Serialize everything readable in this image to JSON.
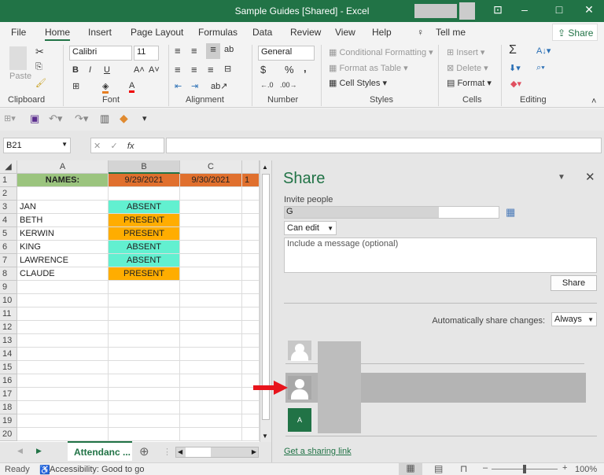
{
  "window": {
    "title": "Sample Guides [Shared]  -  Excel",
    "accent": "#217346"
  },
  "tabs": [
    "File",
    "Home",
    "Insert",
    "Page Layout",
    "Formulas",
    "Data",
    "Review",
    "View",
    "Help",
    "Tell me"
  ],
  "share_button": "Share",
  "ribbon": {
    "clipboard": {
      "label": "Clipboard",
      "paste": "Paste"
    },
    "font": {
      "label": "Font",
      "name": "Calibri",
      "size": "11",
      "bold": "B",
      "italic": "I",
      "underline": "U"
    },
    "alignment": {
      "label": "Alignment"
    },
    "number": {
      "label": "Number",
      "format": "General",
      "currency": "$",
      "percent": "%",
      "comma": ","
    },
    "styles": {
      "label": "Styles",
      "conditional": "Conditional Formatting",
      "table": "Format as Table",
      "cell_styles": "Cell Styles"
    },
    "cells": {
      "label": "Cells",
      "insert": "Insert",
      "delete": "Delete",
      "format": "Format"
    },
    "editing": {
      "label": "Editing",
      "sum": "Σ"
    }
  },
  "formula_bar": {
    "name_box": "B21",
    "fx": "fx",
    "value": ""
  },
  "sheet": {
    "columns": [
      "A",
      "B",
      "C"
    ],
    "rows": [
      "1",
      "2",
      "3",
      "4",
      "5",
      "6",
      "7",
      "8",
      "9",
      "10",
      "11",
      "12",
      "13",
      "14",
      "15",
      "16",
      "17",
      "18",
      "19",
      "20"
    ],
    "header": {
      "a": "NAMES:",
      "b": "9/29/2021",
      "c": "9/30/2021",
      "d": "1"
    },
    "records": [
      {
        "name": "JAN",
        "status": "ABSENT"
      },
      {
        "name": "BETH",
        "status": "PRESENT"
      },
      {
        "name": "KERWIN",
        "status": "PRESENT"
      },
      {
        "name": "KING",
        "status": "ABSENT"
      },
      {
        "name": "LAWRENCE",
        "status": "ABSENT"
      },
      {
        "name": "CLAUDE",
        "status": "PRESENT"
      }
    ],
    "colors": {
      "names_header": "#9bc47e",
      "date_header": "#e0702e",
      "absent": "#62f0d0",
      "present": "#ffad00"
    },
    "active_tab": "Attendanc",
    "more_tabs": "..."
  },
  "share_pane": {
    "title": "Share",
    "invite_label": "Invite people",
    "invite_value": "G",
    "permission": "Can edit",
    "message_placeholder": "Include a message (optional)",
    "share_button": "Share",
    "auto_share_label": "Automatically share changes:",
    "auto_share_value": "Always",
    "avatar_initial": "A",
    "link": "Get a sharing link"
  },
  "status": {
    "ready": "Ready",
    "accessibility": "Accessibility: Good to go",
    "zoom": "100%"
  }
}
